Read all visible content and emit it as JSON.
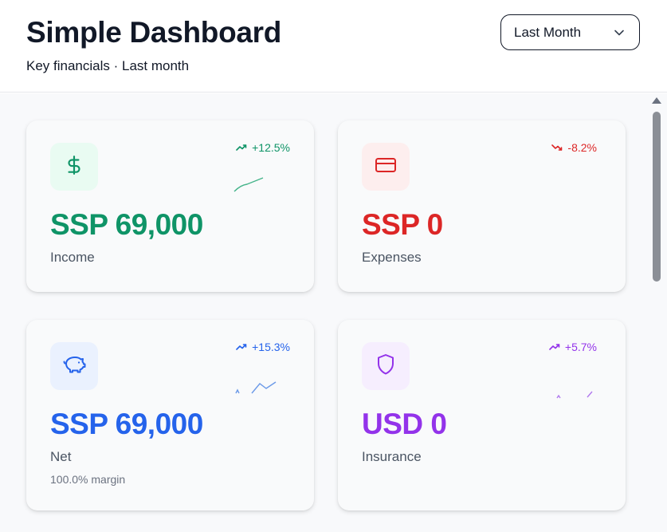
{
  "header": {
    "title": "Simple Dashboard",
    "subtitle": "Key financials · Last month",
    "period_select": {
      "value": "Last Month",
      "icon": "chevron-down-icon"
    }
  },
  "cards": [
    {
      "name": "Income",
      "value": "SSP 69,000",
      "trend": "+12.5%",
      "trend_direction": "up",
      "icon": "dollar-icon",
      "color": "#0f9467",
      "icon_bg": "#e9fbf2"
    },
    {
      "name": "Expenses",
      "value": "SSP 0",
      "trend": "-8.2%",
      "trend_direction": "down",
      "icon": "credit-card-icon",
      "color": "#dc2626",
      "icon_bg": "#fdeeee"
    },
    {
      "name": "Net",
      "value": "SSP 69,000",
      "subtext": "100.0% margin",
      "trend": "+15.3%",
      "trend_direction": "up",
      "icon": "piggy-bank-icon",
      "color": "#2563eb",
      "icon_bg": "#eaf1fe"
    },
    {
      "name": "Insurance",
      "value": "USD 0",
      "trend": "+5.7%",
      "trend_direction": "up",
      "icon": "shield-icon",
      "color": "#9333ea",
      "icon_bg": "#f6eefe"
    }
  ],
  "colors": {
    "text_primary": "#111827",
    "text_muted": "#4b5563",
    "background": "#f8f9fb",
    "scrollbar_thumb": "#8b8f96"
  }
}
